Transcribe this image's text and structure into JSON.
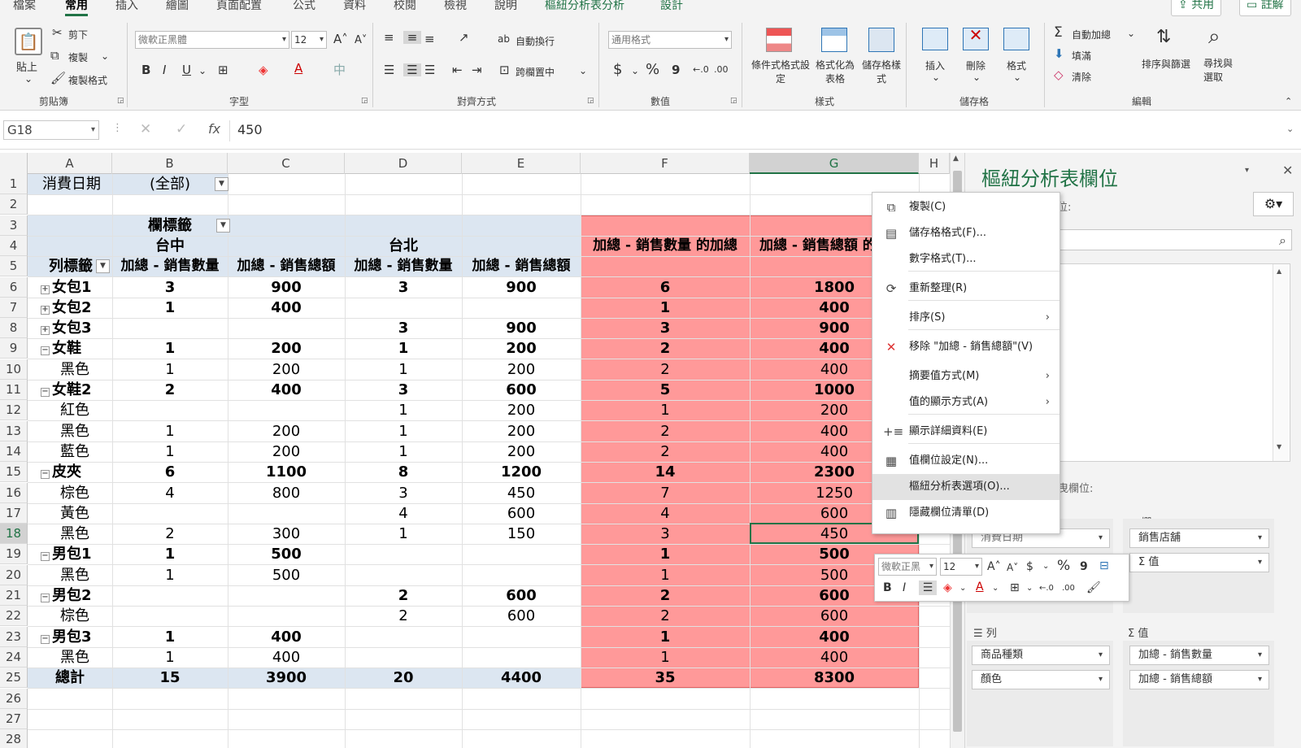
{
  "tabs": [
    "檔案",
    "常用",
    "插入",
    "繪圖",
    "頁面配置",
    "公式",
    "資料",
    "校閱",
    "檢視",
    "說明",
    "樞紐分析表分析",
    "設計"
  ],
  "top_buttons": {
    "share": "共用",
    "comment": "註解"
  },
  "ribbon": {
    "clipboard": {
      "paste": "貼上",
      "cut": "剪下",
      "copy": "複製",
      "format_painter": "複製格式",
      "label": "剪貼簿"
    },
    "font": {
      "name": "微軟正黑體",
      "size": "12",
      "bold": "B",
      "italic": "I",
      "underline": "U",
      "label": "字型"
    },
    "alignment": {
      "wrap": "自動換行",
      "merge": "跨欄置中",
      "label": "對齊方式"
    },
    "number": {
      "format": "通用格式",
      "currency": "$",
      "percent": "%",
      "comma": "9",
      "label": "數值"
    },
    "styles": {
      "conditional": "條件式格式設定",
      "table": "格式化為表格",
      "cell_styles": "儲存格樣式",
      "label": "樣式"
    },
    "cells": {
      "insert": "插入",
      "delete": "刪除",
      "format": "格式",
      "label": "儲存格"
    },
    "editing": {
      "autosum": "自動加總",
      "fill": "填滿",
      "clear": "清除",
      "sort": "排序與篩選",
      "find": "尋找與選取",
      "label": "編輯"
    }
  },
  "formula_bar": {
    "name_box": "G18",
    "fx": "fx",
    "value": "450"
  },
  "columns": [
    "A",
    "B",
    "C",
    "D",
    "E",
    "F",
    "G",
    "H"
  ],
  "rows": [
    "1",
    "2",
    "3",
    "4",
    "5",
    "6",
    "7",
    "8",
    "9",
    "10",
    "11",
    "12",
    "13",
    "14",
    "15",
    "16",
    "17",
    "18",
    "19",
    "20",
    "21",
    "22",
    "23",
    "24",
    "25",
    "26",
    "27",
    "28"
  ],
  "pivot": {
    "filter_label": "消費日期",
    "filter_value": "(全部)",
    "col_labels": "欄標籤",
    "city1": "台中",
    "city2": "台北",
    "row_labels": "列標籤",
    "qty_header": "加總 - 銷售數量",
    "amt_header": "加總 - 銷售總額",
    "f_header": "加總 - 銷售數量 的加總",
    "g_header": "加總 - 銷售總額 的",
    "data": [
      {
        "label": "女包1",
        "lvl": 0,
        "exp": "+",
        "b": "3",
        "c": "900",
        "d": "3",
        "e": "900",
        "f": "6",
        "g": "1800"
      },
      {
        "label": "女包2",
        "lvl": 0,
        "exp": "+",
        "b": "1",
        "c": "400",
        "d": "",
        "e": "",
        "f": "1",
        "g": "400"
      },
      {
        "label": "女包3",
        "lvl": 0,
        "exp": "+",
        "b": "",
        "c": "",
        "d": "3",
        "e": "900",
        "f": "3",
        "g": "900"
      },
      {
        "label": "女鞋",
        "lvl": 0,
        "exp": "−",
        "b": "1",
        "c": "200",
        "d": "1",
        "e": "200",
        "f": "2",
        "g": "400"
      },
      {
        "label": "黑色",
        "lvl": 1,
        "exp": "",
        "b": "1",
        "c": "200",
        "d": "1",
        "e": "200",
        "f": "2",
        "g": "400"
      },
      {
        "label": "女鞋2",
        "lvl": 0,
        "exp": "−",
        "b": "2",
        "c": "400",
        "d": "3",
        "e": "600",
        "f": "5",
        "g": "1000"
      },
      {
        "label": "紅色",
        "lvl": 1,
        "exp": "",
        "b": "",
        "c": "",
        "d": "1",
        "e": "200",
        "f": "1",
        "g": "200"
      },
      {
        "label": "黑色",
        "lvl": 1,
        "exp": "",
        "b": "1",
        "c": "200",
        "d": "1",
        "e": "200",
        "f": "2",
        "g": "400"
      },
      {
        "label": "藍色",
        "lvl": 1,
        "exp": "",
        "b": "1",
        "c": "200",
        "d": "1",
        "e": "200",
        "f": "2",
        "g": "400"
      },
      {
        "label": "皮夾",
        "lvl": 0,
        "exp": "−",
        "b": "6",
        "c": "1100",
        "d": "8",
        "e": "1200",
        "f": "14",
        "g": "2300"
      },
      {
        "label": "棕色",
        "lvl": 1,
        "exp": "",
        "b": "4",
        "c": "800",
        "d": "3",
        "e": "450",
        "f": "7",
        "g": "1250"
      },
      {
        "label": "黃色",
        "lvl": 1,
        "exp": "",
        "b": "",
        "c": "",
        "d": "4",
        "e": "600",
        "f": "4",
        "g": "600"
      },
      {
        "label": "黑色",
        "lvl": 1,
        "exp": "",
        "b": "2",
        "c": "300",
        "d": "1",
        "e": "150",
        "f": "3",
        "g": "450"
      },
      {
        "label": "男包1",
        "lvl": 0,
        "exp": "−",
        "b": "1",
        "c": "500",
        "d": "",
        "e": "",
        "f": "1",
        "g": "500"
      },
      {
        "label": "黑色",
        "lvl": 1,
        "exp": "",
        "b": "1",
        "c": "500",
        "d": "",
        "e": "",
        "f": "1",
        "g": "500"
      },
      {
        "label": "男包2",
        "lvl": 0,
        "exp": "−",
        "b": "",
        "c": "",
        "d": "2",
        "e": "600",
        "f": "2",
        "g": "600"
      },
      {
        "label": "棕色",
        "lvl": 1,
        "exp": "",
        "b": "",
        "c": "",
        "d": "2",
        "e": "600",
        "f": "2",
        "g": "600"
      },
      {
        "label": "男包3",
        "lvl": 0,
        "exp": "−",
        "b": "1",
        "c": "400",
        "d": "",
        "e": "",
        "f": "1",
        "g": "400"
      },
      {
        "label": "黑色",
        "lvl": 1,
        "exp": "",
        "b": "1",
        "c": "400",
        "d": "",
        "e": "",
        "f": "1",
        "g": "400"
      }
    ],
    "total": {
      "label": "總計",
      "b": "15",
      "c": "3900",
      "d": "20",
      "e": "4400",
      "f": "35",
      "g": "8300"
    }
  },
  "context_menu": {
    "items": [
      {
        "label": "複製(C)",
        "icon": "copy-icon",
        "glyph": "⧉",
        "arrow": false
      },
      {
        "label": "儲存格格式(F)...",
        "icon": "format-cells-icon",
        "glyph": "▤",
        "arrow": false
      },
      {
        "label": "數字格式(T)...",
        "icon": "",
        "glyph": "",
        "arrow": false
      },
      {
        "label": "重新整理(R)",
        "icon": "refresh-icon",
        "glyph": "⟳",
        "arrow": false
      },
      {
        "label": "排序(S)",
        "icon": "",
        "glyph": "",
        "arrow": true
      },
      {
        "label": "移除 \"加總 - 銷售總額\"(V)",
        "icon": "remove-icon",
        "glyph": "✕",
        "arrow": false
      },
      {
        "label": "摘要值方式(M)",
        "icon": "",
        "glyph": "",
        "arrow": true
      },
      {
        "label": "值的顯示方式(A)",
        "icon": "",
        "glyph": "",
        "arrow": true
      },
      {
        "label": "顯示詳細資料(E)",
        "icon": "show-details-icon",
        "glyph": "+≡",
        "arrow": false
      },
      {
        "label": "值欄位設定(N)...",
        "icon": "value-field-settings-icon",
        "glyph": "▦",
        "arrow": false
      },
      {
        "label": "樞紐分析表選項(O)...",
        "icon": "",
        "glyph": "",
        "arrow": false
      },
      {
        "label": "隱藏欄位清單(D)",
        "icon": "hide-field-list-icon",
        "glyph": "▥",
        "arrow": false
      }
    ]
  },
  "mini_toolbar": {
    "font": "微軟正黑",
    "size": "12",
    "bold": "B",
    "italic": "I"
  },
  "pane": {
    "title": "樞紐分析表欄位",
    "choose_fields": "表的欄位:",
    "drag_label": "間拖曳欄位:",
    "filters_value": "消費日期",
    "columns_header": "欄",
    "columns_items": [
      "銷售店舖",
      "Σ 值"
    ],
    "rows_header": "列",
    "rows_items": [
      "商品種類",
      "顏色"
    ],
    "values_header": "Σ 值",
    "values_items": [
      "加總 - 銷售數量",
      "加總 - 銷售總額"
    ]
  },
  "colors": {
    "accent": "#217346",
    "highlight": "#ff9999",
    "pivot_header": "#dce6f1"
  }
}
